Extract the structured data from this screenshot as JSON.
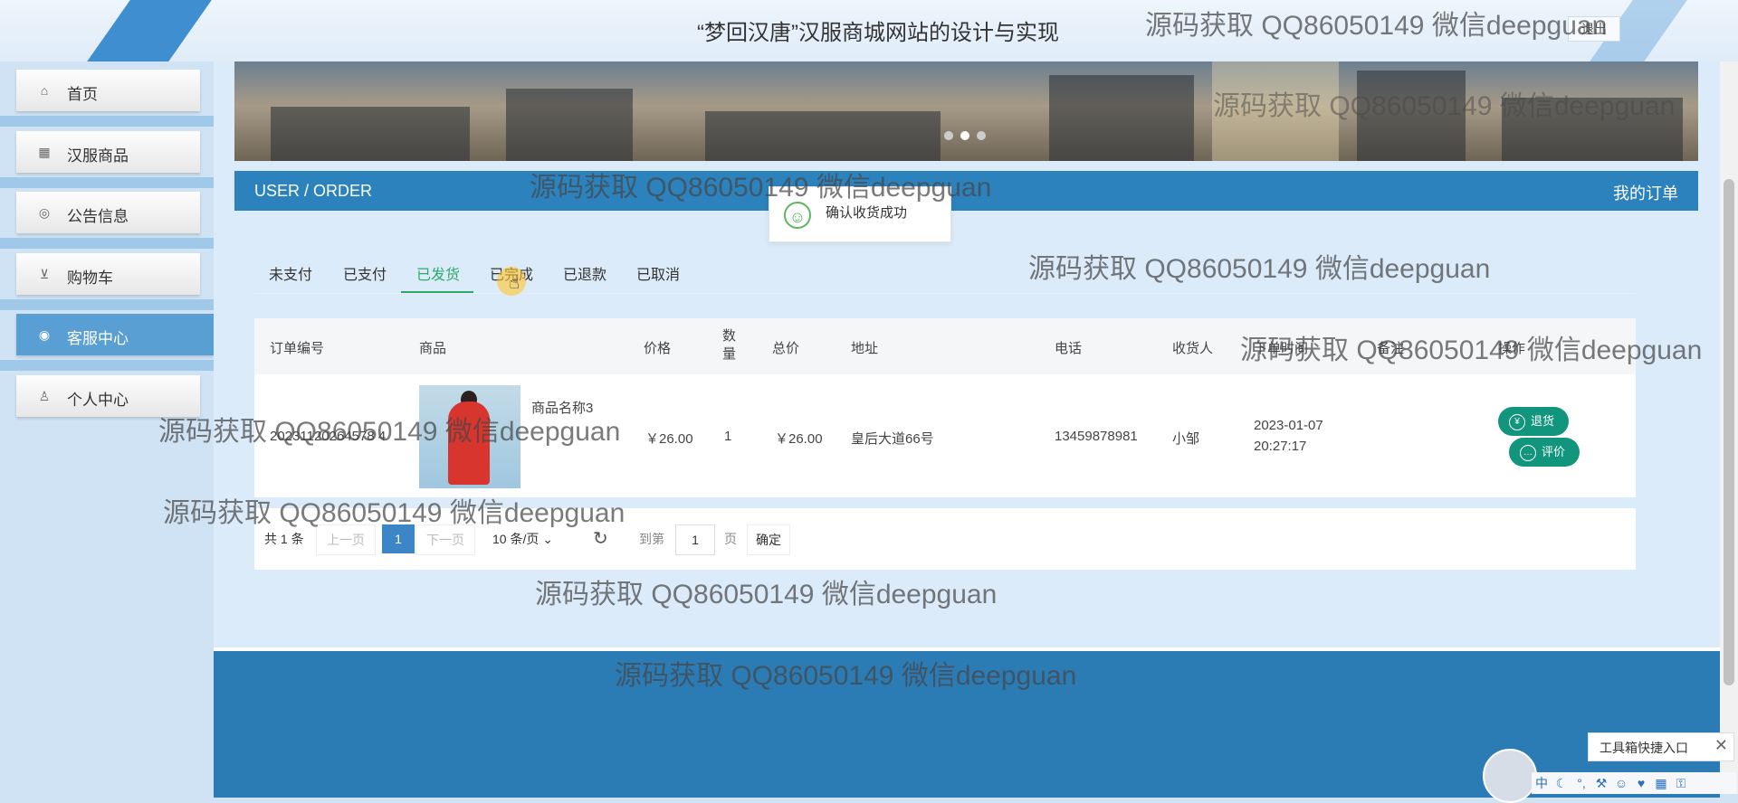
{
  "header": {
    "title": "“梦回汉唐”汉服商城网站的设计与实现",
    "logout_label": "退出"
  },
  "sidebar": {
    "items": [
      {
        "label": "首页",
        "icon": "home-icon"
      },
      {
        "label": "汉服商品",
        "icon": "goods-icon"
      },
      {
        "label": "公告信息",
        "icon": "globe-icon"
      },
      {
        "label": "购物车",
        "icon": "cart-icon"
      },
      {
        "label": "客服中心",
        "icon": "chat-icon",
        "active": true
      },
      {
        "label": "个人中心",
        "icon": "user-icon"
      }
    ]
  },
  "section": {
    "left": "USER / ORDER",
    "right": "我的订单"
  },
  "toast": {
    "message": "确认收货成功"
  },
  "tabs": [
    {
      "label": "未支付"
    },
    {
      "label": "已支付"
    },
    {
      "label": "已发货",
      "active": true
    },
    {
      "label": "已完成"
    },
    {
      "label": "已退款"
    },
    {
      "label": "已取消"
    }
  ],
  "table": {
    "headers": [
      "订单编号",
      "商品",
      "价格",
      "数量",
      "总价",
      "地址",
      "电话",
      "收货人",
      "下单时间",
      "备注",
      "操作"
    ],
    "rows": [
      {
        "order_no": "20231120264578 4",
        "product_name": "商品名称3",
        "price": "￥26.00",
        "qty": "1",
        "total": "￥26.00",
        "address": "皇后大道66号",
        "phone": "13459878981",
        "receiver": "小邹",
        "date": "2023-01-07",
        "time": "20:27:17",
        "actions": [
          "退货",
          "评价"
        ]
      }
    ]
  },
  "pagination": {
    "total": "共 1 条",
    "prev": "上一页",
    "current": "1",
    "next": "下一页",
    "page_size": "10 条/页",
    "goto": "到第",
    "goto_value": "1",
    "page_unit": "页",
    "confirm": "确定"
  },
  "watermark": "源码获取 QQ86050149 微信deepguan",
  "toolbox": {
    "label": "工具箱快捷入口"
  },
  "ime": [
    "中",
    "☾",
    "°,",
    "⚒",
    "☺",
    "♥",
    "▦",
    "⚿"
  ],
  "colors": {
    "primary": "#2b82bd",
    "active_tab": "#2ea86a",
    "action_button": "#11957d"
  }
}
